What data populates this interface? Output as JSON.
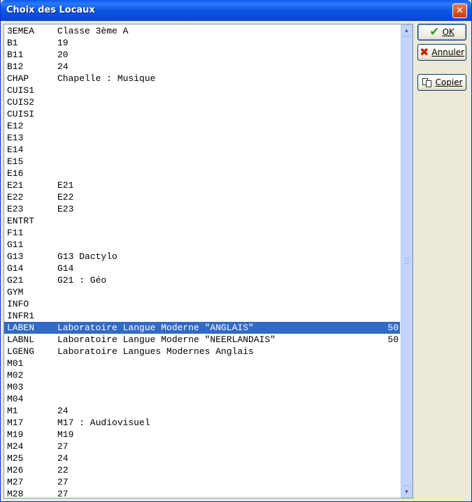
{
  "window": {
    "title": "Choix des Locaux",
    "close_glyph": "✕"
  },
  "buttons": {
    "ok": "OK",
    "cancel": "Annuler",
    "copy": "Copier"
  },
  "icons": {
    "ok": "check-icon",
    "cancel": "x-icon",
    "copy": "copy-icon"
  },
  "colors": {
    "selection": "#316ac5",
    "titlebar": "#0a56e6"
  },
  "selected_index": 27,
  "rows": [
    {
      "code": "3EMEA",
      "desc": "Classe 3ème A",
      "num": ""
    },
    {
      "code": "B1",
      "desc": "19",
      "num": ""
    },
    {
      "code": "B11",
      "desc": "20",
      "num": ""
    },
    {
      "code": "B12",
      "desc": "24",
      "num": ""
    },
    {
      "code": "CHAP",
      "desc": "Chapelle : Musique",
      "num": ""
    },
    {
      "code": "CUIS1",
      "desc": "",
      "num": ""
    },
    {
      "code": "CUIS2",
      "desc": "",
      "num": ""
    },
    {
      "code": "CUISI",
      "desc": "",
      "num": ""
    },
    {
      "code": "E12",
      "desc": "",
      "num": ""
    },
    {
      "code": "E13",
      "desc": "",
      "num": ""
    },
    {
      "code": "E14",
      "desc": "",
      "num": ""
    },
    {
      "code": "E15",
      "desc": "",
      "num": ""
    },
    {
      "code": "E16",
      "desc": "",
      "num": ""
    },
    {
      "code": "E21",
      "desc": "E21",
      "num": ""
    },
    {
      "code": "E22",
      "desc": "E22",
      "num": ""
    },
    {
      "code": "E23",
      "desc": "E23",
      "num": ""
    },
    {
      "code": "ENTRT",
      "desc": "",
      "num": ""
    },
    {
      "code": "F11",
      "desc": "",
      "num": ""
    },
    {
      "code": "G11",
      "desc": "",
      "num": ""
    },
    {
      "code": "G13",
      "desc": "G13 Dactylo",
      "num": ""
    },
    {
      "code": "G14",
      "desc": "G14",
      "num": ""
    },
    {
      "code": "G21",
      "desc": "G21 : Géo",
      "num": ""
    },
    {
      "code": "GYM",
      "desc": "",
      "num": ""
    },
    {
      "code": "INFO",
      "desc": "",
      "num": ""
    },
    {
      "code": "INFR1",
      "desc": "",
      "num": ""
    },
    {
      "code": "LABEN",
      "desc": "Laboratoire Langue Moderne \"ANGLAIS\"",
      "num": "50"
    },
    {
      "code": "LABNL",
      "desc": "Laboratoire Langue Moderne \"NEERLANDAIS\"",
      "num": "50"
    },
    {
      "code": "LGENG",
      "desc": "Laboratoire Langues Modernes Anglais",
      "num": ""
    },
    {
      "code": "M01",
      "desc": "",
      "num": ""
    },
    {
      "code": "M02",
      "desc": "",
      "num": ""
    },
    {
      "code": "M03",
      "desc": "",
      "num": ""
    },
    {
      "code": "M04",
      "desc": "",
      "num": ""
    },
    {
      "code": "M1",
      "desc": "24",
      "num": ""
    },
    {
      "code": "M17",
      "desc": "M17 : Audiovisuel",
      "num": ""
    },
    {
      "code": "M19",
      "desc": "M19",
      "num": ""
    },
    {
      "code": "M24",
      "desc": "27",
      "num": ""
    },
    {
      "code": "M25",
      "desc": "24",
      "num": ""
    },
    {
      "code": "M26",
      "desc": "22",
      "num": ""
    },
    {
      "code": "M27",
      "desc": "27",
      "num": ""
    },
    {
      "code": "M28",
      "desc": "27",
      "num": ""
    }
  ]
}
